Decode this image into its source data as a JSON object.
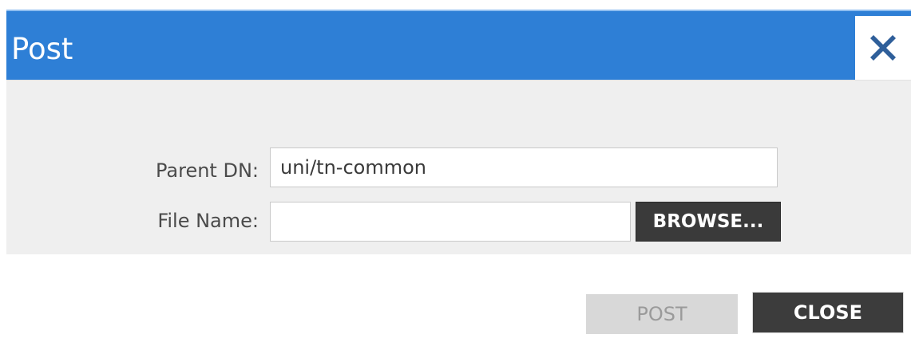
{
  "dialog": {
    "title": "Post",
    "close_icon": "close-x-icon",
    "accent_color": "#2e7fd6"
  },
  "form": {
    "parent_dn_label": "Parent DN:",
    "parent_dn_value": "uni/tn-common",
    "file_name_label": "File Name:",
    "file_name_value": "",
    "browse_label": "BROWSE..."
  },
  "footer": {
    "post_label": "POST",
    "close_label": "CLOSE"
  }
}
